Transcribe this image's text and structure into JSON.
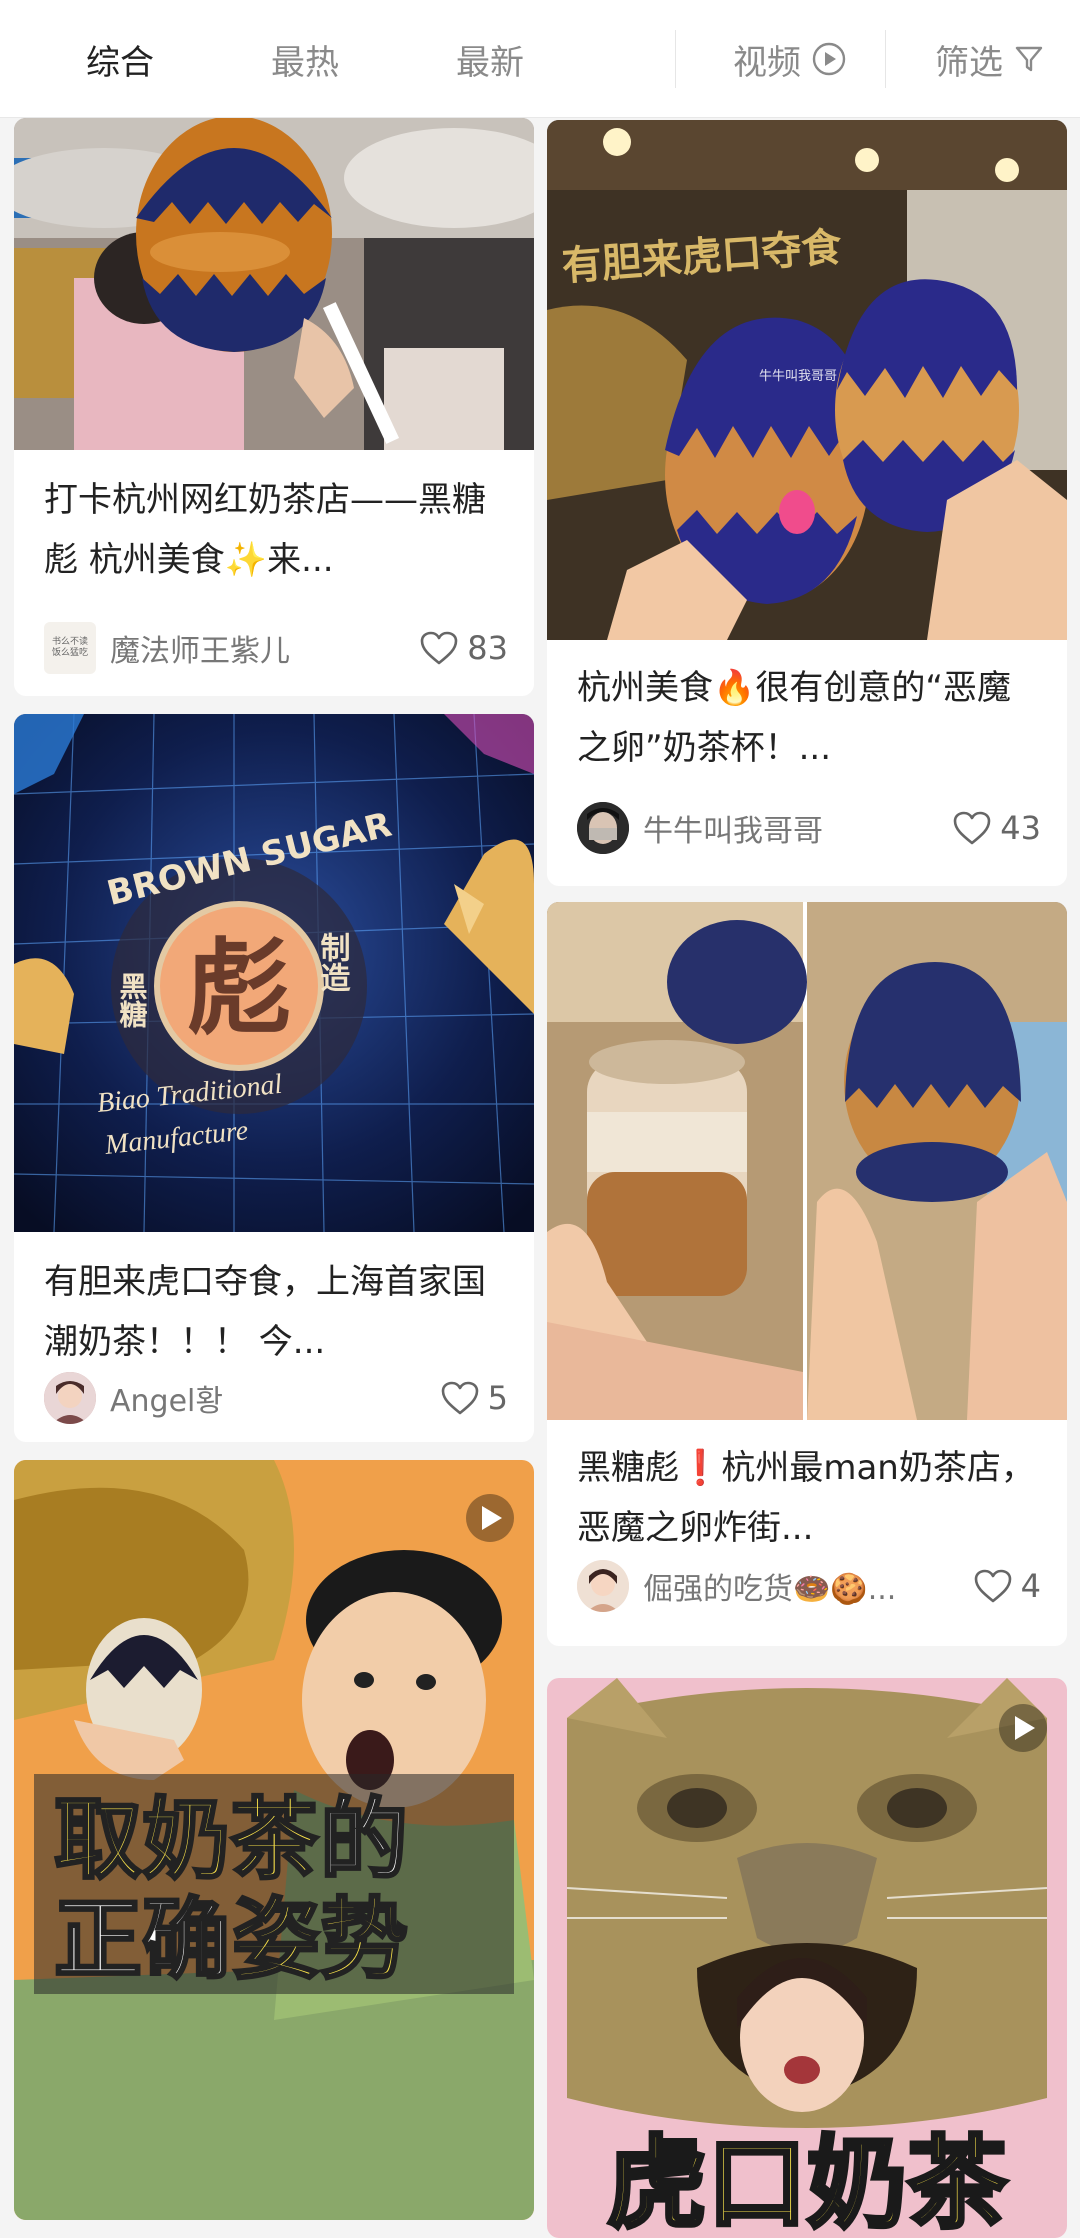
{
  "tabs": {
    "all": "综合",
    "hot": "最热",
    "new": "最新",
    "video": "视频",
    "filter": "筛选"
  },
  "icons": {
    "video": "play-circle-icon",
    "filter": "funnel-icon",
    "like": "heart-outline-icon",
    "play": "play-icon"
  },
  "colors": {
    "active_tab": "#222222",
    "inactive_tab": "#8a8a8a",
    "background": "#f4f4f4"
  },
  "feed": {
    "left": [
      {
        "title": "打卡杭州网红奶茶店——黑糖彪 杭州美食✨来...",
        "author": "魔法师王紫儿",
        "avatar_text": "书么不读 饭么猛吃",
        "likes": "83"
      },
      {
        "title": "有胆来虎口夺食，上海首家国潮奶茶！！！ 今...",
        "author": "Angel황",
        "likes": "5",
        "image_sign": {
          "brand": "BROWN SUGAR",
          "char": "彪",
          "left": "黑糖",
          "right": "制造",
          "line1": "Biao Traditional",
          "line2": "Manufacture"
        }
      },
      {
        "video_text_1a": "取奶茶",
        "video_text_1b": "的",
        "video_text_2a": "正确",
        "video_text_2b": "姿势"
      }
    ],
    "right": [
      {
        "title": "杭州美食🔥很有创意的“恶魔之卵”奶茶杯！...",
        "author": "牛牛叫我哥哥",
        "likes": "43",
        "image_sign": "有胆来虎口夺食",
        "watermark": "牛牛叫我哥哥"
      },
      {
        "title": "黑糖彪❗️杭州最man奶茶店，恶魔之卵炸街...",
        "author": "倔强的吃货🍩🍪...",
        "likes": "4"
      },
      {
        "video_text": "虎口奶茶"
      }
    ]
  }
}
